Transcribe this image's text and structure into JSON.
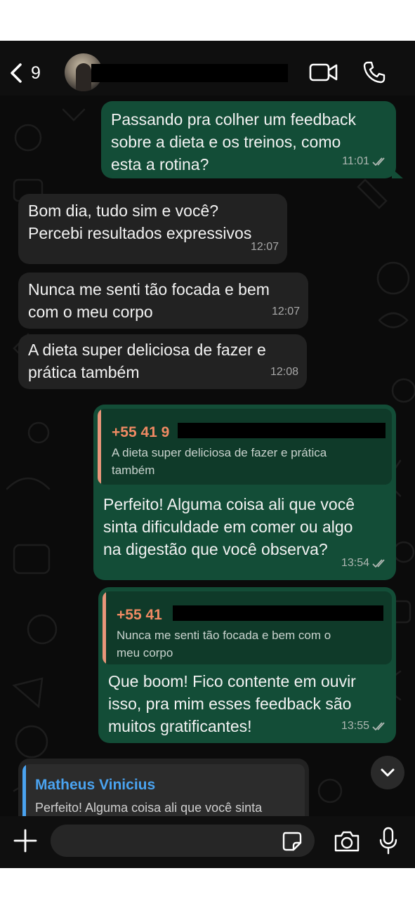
{
  "header": {
    "back_count": "9",
    "icons": {
      "back": "chevron-left-icon",
      "video": "video-call-icon",
      "phone": "phone-call-icon"
    }
  },
  "messages": [
    {
      "direction": "outgoing",
      "text": "Passando pra colher um feedback\nsobre a dieta e os treinos, como\nesta a rotina?",
      "time": "11:01",
      "status": "read"
    },
    {
      "direction": "incoming",
      "text": "Bom dia, tudo sim e você?\nPercebi resultados expressivos",
      "time": "12:07"
    },
    {
      "direction": "incoming",
      "text": "Nunca me senti tão focada e bem\ncom o meu corpo",
      "time": "12:07"
    },
    {
      "direction": "incoming",
      "text": "A dieta super deliciosa de fazer e\nprática também",
      "time": "12:08"
    },
    {
      "direction": "outgoing",
      "quote": {
        "author": "+55 41 9",
        "text": "A dieta super deliciosa de fazer e prática\ntambém"
      },
      "text": "Perfeito! Alguma coisa ali que você\nsinta dificuldade em comer ou algo\nna digestão que você observa?",
      "time": "13:54",
      "status": "read"
    },
    {
      "direction": "outgoing",
      "quote": {
        "author": "+55 41",
        "text": "Nunca me senti tão focada e bem com o\nmeu corpo"
      },
      "text": "Que boom! Fico contente em ouvir\nisso, pra mim esses feedback são\nmuitos gratificantes!",
      "time": "13:55",
      "status": "read"
    },
    {
      "direction": "incoming",
      "quote": {
        "author": "Matheus Vinicius",
        "text": "Perfeito! Alguma coisa ali que você sinta"
      }
    }
  ],
  "composer": {
    "placeholder": ""
  },
  "colors": {
    "outgoing_bubble": "#134d37",
    "incoming_bubble": "#222222",
    "quote_accent_outgoing": "#f08a63",
    "quote_accent_incoming": "#4aa3f0",
    "background": "#0b0b0b"
  }
}
